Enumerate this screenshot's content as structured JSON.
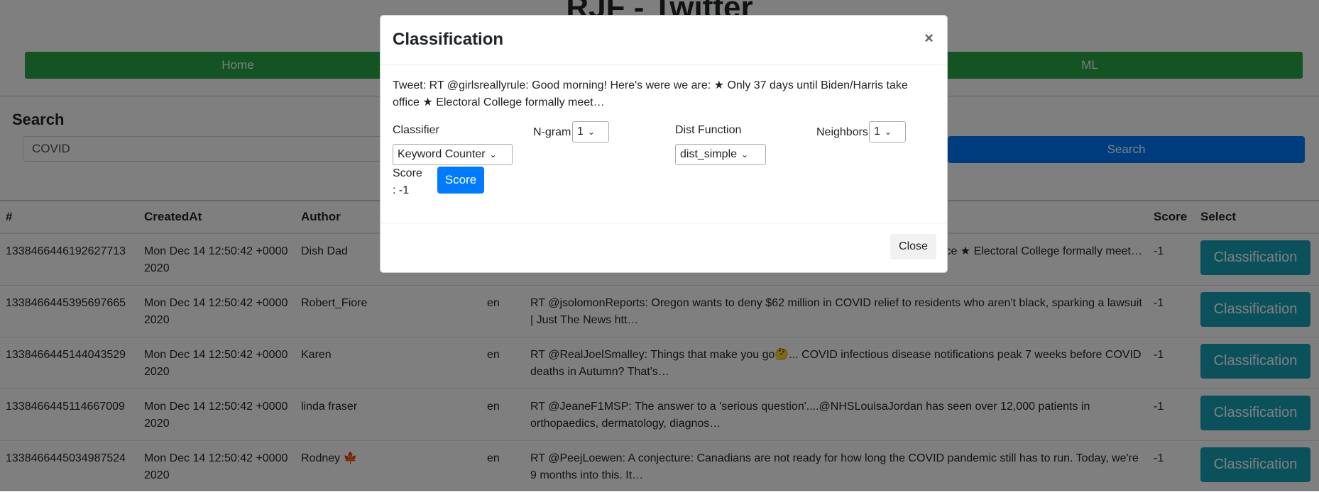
{
  "app": {
    "title": "RJF - Twitter"
  },
  "nav": [
    "Home",
    "",
    "ML"
  ],
  "search": {
    "label": "Search",
    "value": "COVID",
    "button": "Search"
  },
  "table": {
    "headers": [
      "#",
      "CreatedAt",
      "Author",
      "",
      "",
      "Score",
      "Select"
    ],
    "rows": [
      {
        "id": "1338466446192627713",
        "created": "Mon Dec 14 12:50:42 +0000 2020",
        "author": "Dish Dad",
        "lang": "",
        "text": "n/Harris take office ★ Electoral College formally meet…",
        "score": "-1",
        "button": "Classification"
      },
      {
        "id": "1338466445395697665",
        "created": "Mon Dec 14 12:50:42 +0000 2020",
        "author": "Robert_Fiore",
        "lang": "en",
        "text": "RT @jsolomonReports: Oregon wants to deny $62 million in COVID relief to residents who aren't black, sparking a lawsuit | Just The News htt…",
        "score": "-1",
        "button": "Classification"
      },
      {
        "id": "1338466445144043529",
        "created": "Mon Dec 14 12:50:42 +0000 2020",
        "author": "Karen",
        "lang": "en",
        "text": "RT @RealJoelSmalley: Things that make you go🤔... COVID infectious disease notifications peak 7 weeks before COVID deaths in Autumn? That's…",
        "score": "-1",
        "button": "Classification"
      },
      {
        "id": "1338466445114667009",
        "created": "Mon Dec 14 12:50:42 +0000 2020",
        "author": "linda fraser",
        "lang": "en",
        "text": "RT @JeaneF1MSP: The answer to a 'serious question'....@NHSLouisaJordan has seen over 12,000 patients in orthopaedics, dermatology, diagnos…",
        "score": "-1",
        "button": "Classification"
      },
      {
        "id": "1338466445034987524",
        "created": "Mon Dec 14 12:50:42 +0000 2020",
        "author": "Rodney",
        "author_flag": "🍁",
        "lang": "en",
        "text": "RT @PeejLoewen: A conjecture: Canadians are not ready for how long the COVID pandemic still has to run. Today, we're 9 months into this. It…",
        "score": "-1",
        "button": "Classification"
      }
    ]
  },
  "modal": {
    "title": "Classification",
    "close_x": "×",
    "tweet": "Tweet: RT @girlsreallyrule: Good morning! Here's were we are: ★ Only 37 days until Biden/Harris take office ★ Electoral College formally meet…",
    "classifier_label": "Classifier",
    "classifier_value": "Keyword Counter",
    "ngram_label": "N-gram",
    "ngram_value": "1",
    "dist_label": "Dist Function",
    "dist_value": "dist_simple",
    "neighbors_label": "Neighbors",
    "neighbors_value": "1",
    "score_label": "Score",
    "score_value": ": -1",
    "score_button": "Score",
    "close_button": "Close"
  }
}
